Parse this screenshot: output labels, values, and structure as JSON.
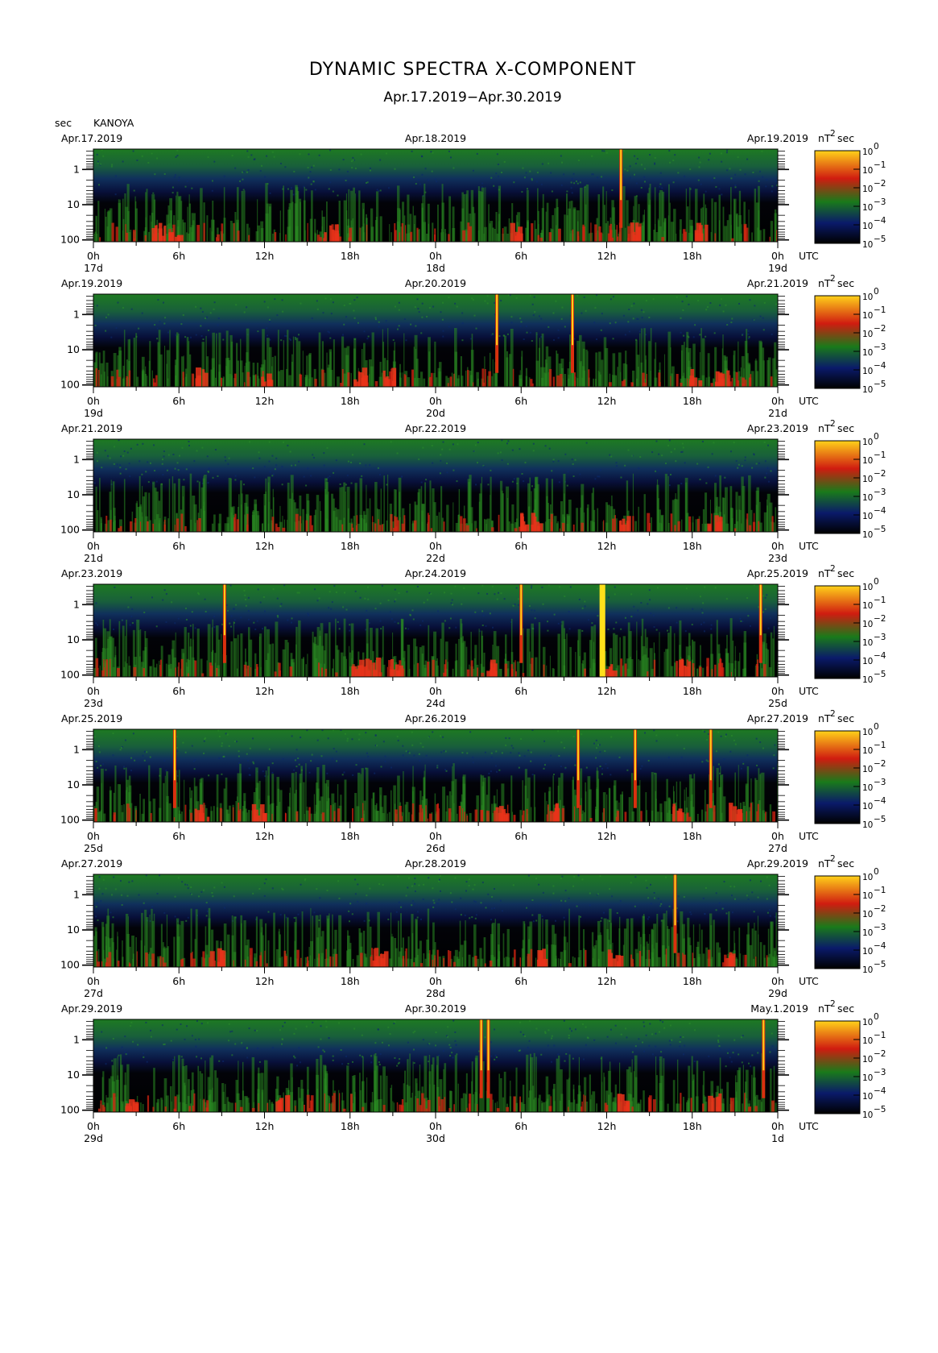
{
  "header": {
    "title": "DYNAMIC SPECTRA X-COMPONENT",
    "subtitle": "Apr.17.2019−Apr.30.2019",
    "station": "KANOYA",
    "period_axis_unit": "sec"
  },
  "chart_data": {
    "type": "heatmap",
    "description_units": {
      "y": "period (sec, log scale, inverted)",
      "color": "power nT^2 sec (log)"
    },
    "y_ticks": [
      "1",
      "10",
      "100"
    ],
    "y_scale": "log",
    "x_ticks": [
      "0h",
      "6h",
      "12h",
      "18h",
      "0h",
      "6h",
      "12h",
      "18h",
      "0h"
    ],
    "x_unit": "UTC",
    "colorbar": {
      "unit_label": "nT",
      "unit_suffix": "sec",
      "stops": [
        "#000000",
        "#0a1a6a",
        "#1a7a1a",
        "#d01c10",
        "#ffd21a"
      ],
      "ticks": [
        "10",
        "10",
        "10",
        "10",
        "10",
        "10"
      ],
      "exponents": [
        "0",
        "−1",
        "−2",
        "−3",
        "−4",
        "−5"
      ],
      "range_log10": [
        -5,
        0
      ]
    },
    "panels": [
      {
        "start_date": "Apr.17.2019",
        "mid_date": "Apr.18.2019",
        "end_date": "Apr.19.2019",
        "day_labels": [
          "17d",
          "18d",
          "19d"
        ],
        "spikes_hours": [
          37.0
        ],
        "hot_hours": [
          4.5,
          5.5,
          16.5,
          29.5,
          38.0,
          42.5
        ]
      },
      {
        "start_date": "Apr.19.2019",
        "mid_date": "Apr.20.2019",
        "end_date": "Apr.21.2019",
        "day_labels": [
          "19d",
          "20d",
          "21d"
        ],
        "spikes_hours": [
          28.3,
          33.6
        ],
        "hot_hours": [
          7.5,
          12.0,
          18.5,
          20.5,
          42.0,
          44.0
        ]
      },
      {
        "start_date": "Apr.21.2019",
        "mid_date": "Apr.22.2019",
        "end_date": "Apr.23.2019",
        "day_labels": [
          "21d",
          "22d",
          "23d"
        ],
        "spikes_hours": [],
        "hot_hours": [
          30.0,
          31.0,
          37.0,
          43.5
        ]
      },
      {
        "start_date": "Apr.23.2019",
        "mid_date": "Apr.24.2019",
        "end_date": "Apr.25.2019",
        "day_labels": [
          "23d",
          "24d",
          "25d"
        ],
        "spikes_hours": [
          9.2,
          30.0,
          46.8
        ],
        "hot_hours": [
          18.5,
          19.5,
          21.0,
          28.0,
          36.0,
          41.5
        ],
        "wide_hours": [
          35.5,
          35.9
        ]
      },
      {
        "start_date": "Apr.25.2019",
        "mid_date": "Apr.26.2019",
        "end_date": "Apr.27.2019",
        "day_labels": [
          "25d",
          "26d",
          "27d"
        ],
        "spikes_hours": [
          5.7,
          34.0,
          38.0,
          43.3
        ],
        "hot_hours": [
          7.5,
          11.5,
          28.5,
          32.0,
          41.0,
          45.0
        ]
      },
      {
        "start_date": "Apr.27.2019",
        "mid_date": "Apr.28.2019",
        "end_date": "Apr.29.2019",
        "day_labels": [
          "27d",
          "28d",
          "29d"
        ],
        "spikes_hours": [
          40.8
        ],
        "hot_hours": [
          8.5,
          20.0,
          31.5,
          36.5,
          44.5
        ]
      },
      {
        "start_date": "Apr.29.2019",
        "mid_date": "Apr.30.2019",
        "end_date": "May.1.2019",
        "day_labels": [
          "29d",
          "30d",
          "1d"
        ],
        "spikes_hours": [
          27.2,
          27.7,
          47.0
        ],
        "hot_hours": [
          2.5,
          13.0,
          37.0,
          43.5
        ]
      }
    ]
  }
}
